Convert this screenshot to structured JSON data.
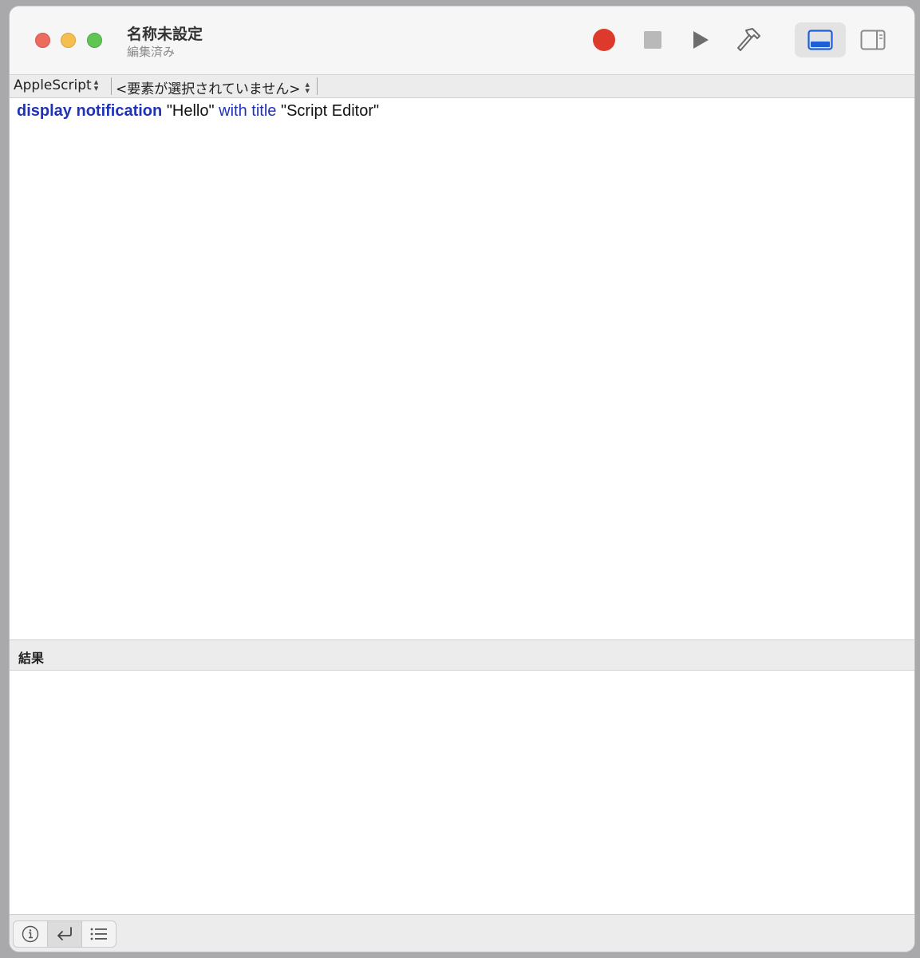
{
  "window": {
    "title": "名称未設定",
    "subtitle": "編集済み"
  },
  "toolbar": {
    "buttons": [
      "record",
      "stop",
      "run",
      "compile",
      "view-result-pane",
      "view-side-pane"
    ],
    "active_view": "view-result-pane",
    "accent_color": "#1f5fd6",
    "record_color": "#de3a2c"
  },
  "navigation": {
    "language": "AppleScript",
    "element": "<要素が選択されていません>"
  },
  "editor": {
    "tokens": [
      {
        "text": "display notification",
        "kind": "command"
      },
      {
        "text": " ",
        "kind": "space"
      },
      {
        "text": "\"Hello\"",
        "kind": "string"
      },
      {
        "text": " ",
        "kind": "space"
      },
      {
        "text": "with title",
        "kind": "parameter"
      },
      {
        "text": " ",
        "kind": "space"
      },
      {
        "text": "\"Script Editor\"",
        "kind": "string"
      }
    ]
  },
  "result": {
    "header": "結果",
    "content": ""
  },
  "bottom_bar": {
    "tabs": [
      "info-icon",
      "return-icon",
      "list-icon"
    ],
    "active_tab": "return-icon"
  }
}
